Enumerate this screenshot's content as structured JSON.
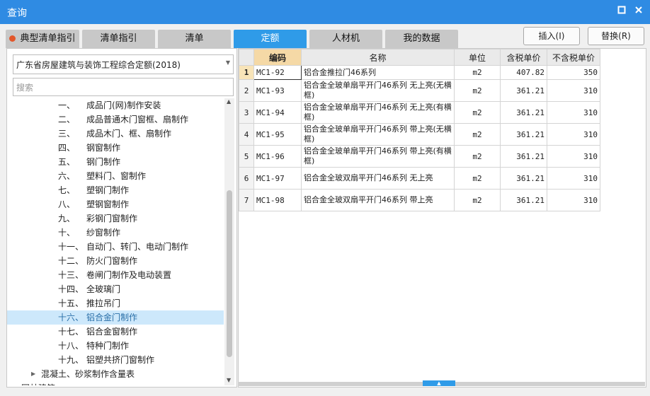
{
  "window": {
    "title": "查询"
  },
  "tabs": [
    {
      "label": "典型清单指引"
    },
    {
      "label": "清单指引"
    },
    {
      "label": "清单"
    },
    {
      "label": "定额"
    },
    {
      "label": "人材机"
    },
    {
      "label": "我的数据"
    }
  ],
  "actions": {
    "insert": "插入(I)",
    "replace": "替换(R)"
  },
  "left": {
    "quota_book": "广东省房屋建筑与装饰工程综合定额(2018)",
    "search_placeholder": "搜索",
    "tree": [
      {
        "num": "一、",
        "label": "成品门(网)制作安装"
      },
      {
        "num": "二、",
        "label": "成品普通木门窗框、扇制作"
      },
      {
        "num": "三、",
        "label": "成品木门、框、扇制作"
      },
      {
        "num": "四、",
        "label": "钢窗制作"
      },
      {
        "num": "五、",
        "label": "钢门制作"
      },
      {
        "num": "六、",
        "label": "塑料门、窗制作"
      },
      {
        "num": "七、",
        "label": "塑钢门制作"
      },
      {
        "num": "八、",
        "label": "塑钢窗制作"
      },
      {
        "num": "九、",
        "label": "彩钢门窗制作"
      },
      {
        "num": "十、",
        "label": "纱窗制作"
      },
      {
        "num": "十一、",
        "label": "自动门、转门、电动门制作"
      },
      {
        "num": "十二、",
        "label": "防火门窗制作"
      },
      {
        "num": "十三、",
        "label": "卷闸门制作及电动装置"
      },
      {
        "num": "十四、",
        "label": "全玻璃门"
      },
      {
        "num": "十五、",
        "label": "推拉吊门"
      },
      {
        "num": "十六、",
        "label": "铝合金门制作"
      },
      {
        "num": "十七、",
        "label": "铝合金窗制作"
      },
      {
        "num": "十八、",
        "label": "特种门制作"
      },
      {
        "num": "十九、",
        "label": "铝塑共挤门窗制作"
      }
    ],
    "tree_group": "混凝土、砂浆制作含量表",
    "tree_group_partial": "园林建筑"
  },
  "grid": {
    "headers": [
      "编码",
      "名称",
      "单位",
      "含税单价",
      "不含税单价"
    ],
    "rows": [
      {
        "n": "1",
        "code": "MC1-92",
        "name": "铝合金推拉门46系列",
        "unit": "m2",
        "tax": "407.82",
        "notax": "350"
      },
      {
        "n": "2",
        "code": "MC1-93",
        "name": "铝合金全玻单扇平开门46系列 无上亮(无横框)",
        "unit": "m2",
        "tax": "361.21",
        "notax": "310"
      },
      {
        "n": "3",
        "code": "MC1-94",
        "name": "铝合金全玻单扇平开门46系列 无上亮(有横框)",
        "unit": "m2",
        "tax": "361.21",
        "notax": "310"
      },
      {
        "n": "4",
        "code": "MC1-95",
        "name": "铝合金全玻单扇平开门46系列 带上亮(无横框)",
        "unit": "m2",
        "tax": "361.21",
        "notax": "310"
      },
      {
        "n": "5",
        "code": "MC1-96",
        "name": "铝合金全玻单扇平开门46系列 带上亮(有横框)",
        "unit": "m2",
        "tax": "361.21",
        "notax": "310"
      },
      {
        "n": "6",
        "code": "MC1-97",
        "name": "铝合金全玻双扇平开门46系列 无上亮",
        "unit": "m2",
        "tax": "361.21",
        "notax": "310"
      },
      {
        "n": "7",
        "code": "MC1-98",
        "name": "铝合金全玻双扇平开门46系列 带上亮",
        "unit": "m2",
        "tax": "361.21",
        "notax": "310"
      }
    ]
  }
}
